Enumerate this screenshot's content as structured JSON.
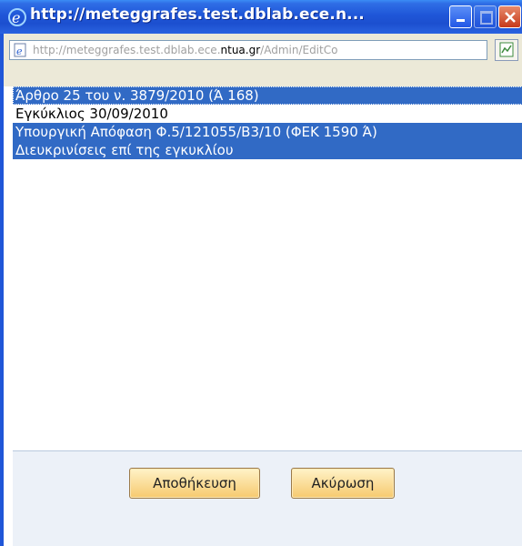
{
  "window": {
    "title": "http://meteggrafes.test.dblab.ece.n..."
  },
  "address": {
    "url_prefix": "http://meteggrafes.test.dblab.ece.",
    "url_domain": "ntua.gr",
    "url_suffix": "/Admin/EditCo"
  },
  "list": {
    "items": [
      {
        "label": "Άρθρο 25 του ν. 3879/2010 (Ά 168)",
        "selected": true
      },
      {
        "label": "Εγκύκλιος 30/09/2010",
        "selected": false
      },
      {
        "label": "Υπουργική Απόφαση Φ.5/121055/Β3/10 (ΦΕΚ 1590 Ά)",
        "selected": true
      },
      {
        "label": "Διευκρινίσεις επί της εγκυκλίου",
        "selected": true
      }
    ]
  },
  "actions": {
    "save_label": "Αποθήκευση",
    "cancel_label": "Ακύρωση"
  },
  "colors": {
    "selection": "#316ac5",
    "titlebar": "#1f56d8",
    "button": "#f6c96e"
  },
  "icons": [
    "ie-logo-icon",
    "minimize-icon",
    "maximize-icon",
    "close-icon",
    "page-icon",
    "compat-icon"
  ]
}
